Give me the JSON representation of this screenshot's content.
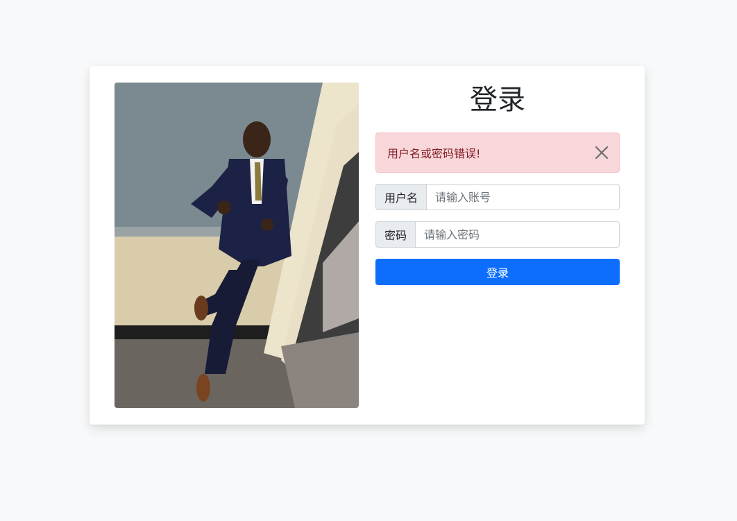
{
  "login": {
    "title": "登录",
    "error_message": "用户名或密码错误!",
    "username_label": "用户名",
    "username_placeholder": "请输入账号",
    "password_label": "密码",
    "password_placeholder": "请输入密码",
    "submit_label": "登录"
  },
  "icons": {
    "close": "close-icon"
  },
  "colors": {
    "primary": "#0d6efd",
    "alert_bg": "#f8d7da",
    "alert_text": "#842029",
    "page_bg": "#f8f9fa"
  }
}
